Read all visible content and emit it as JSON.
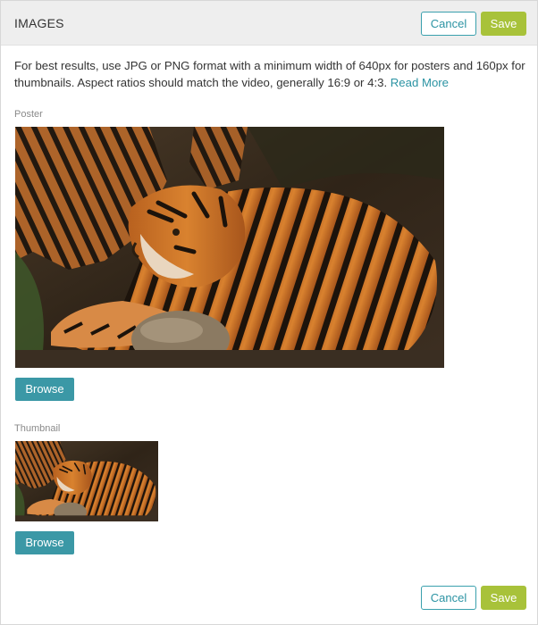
{
  "header": {
    "title": "IMAGES",
    "cancel_label": "Cancel",
    "save_label": "Save"
  },
  "intro": {
    "text": "For best results, use JPG or PNG format with a minimum width of 640px for posters and 160px for thumbnails. Aspect ratios should match the video, generally 16:9 or 4:3. ",
    "link_label": "Read More"
  },
  "poster": {
    "label": "Poster",
    "browse_label": "Browse"
  },
  "thumbnail": {
    "label": "Thumbnail",
    "browse_label": "Browse"
  },
  "footer": {
    "cancel_label": "Cancel",
    "save_label": "Save"
  },
  "colors": {
    "accent": "#3b98a6",
    "save": "#a8c23a",
    "header_bg": "#eeeeee"
  }
}
